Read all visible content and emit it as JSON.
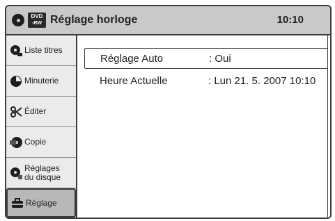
{
  "header": {
    "badge_top": "DVD",
    "badge_bottom": "-RW",
    "title": "Réglage horloge",
    "time": "10:10"
  },
  "sidebar": {
    "items": [
      {
        "label_line1": "Liste titres",
        "label_line2": "",
        "icon": "title-list-icon"
      },
      {
        "label_line1": "Minuterie",
        "label_line2": "",
        "icon": "timer-icon"
      },
      {
        "label_line1": "Éditer",
        "label_line2": "",
        "icon": "edit-scissors-icon"
      },
      {
        "label_line1": "Copie",
        "label_line2": "",
        "icon": "copy-icon"
      },
      {
        "label_line1": "Réglages",
        "label_line2": "du disque",
        "icon": "disc-settings-icon"
      },
      {
        "label_line1": "Réglage",
        "label_line2": "",
        "icon": "setup-toolbox-icon"
      }
    ]
  },
  "main": {
    "rows": [
      {
        "label": "Réglage Auto",
        "value": ": Oui"
      },
      {
        "label": "Heure Actuelle",
        "value": ": Lun 21. 5. 2007 10:10"
      }
    ]
  }
}
